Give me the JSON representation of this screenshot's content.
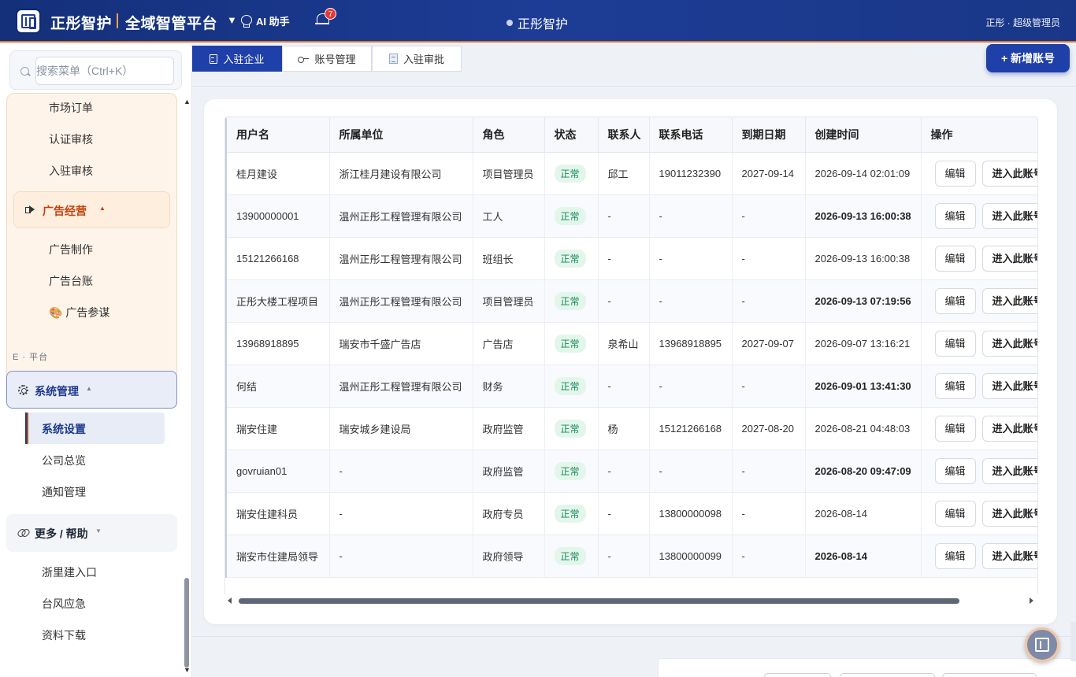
{
  "header": {
    "brand": "正彤智护",
    "platform": "全域智管平台",
    "ai_label": "AI 助手",
    "notification_count": "7",
    "center_title": "正彤智护",
    "user": "正彤 · 超级管理员"
  },
  "sidebar": {
    "search_placeholder": "搜索菜单（Ctrl+K）",
    "top_items": [
      "市场订单",
      "认证审核",
      "入驻审核"
    ],
    "ad_group": {
      "title": "广告经营",
      "items": [
        "广告制作",
        "广告台账",
        "🎨 广告参谋"
      ]
    },
    "section_label": "E · 平台",
    "system_group": {
      "title": "系统管理",
      "active_item": "系统设置",
      "items": [
        "公司总览",
        "通知管理"
      ]
    },
    "help_group": {
      "title": "更多 / 帮助",
      "items": [
        "浙里建入口",
        "台风应急",
        "资料下载"
      ]
    }
  },
  "tabs": [
    {
      "label": "入驻企业",
      "active": true
    },
    {
      "label": "账号管理",
      "active": false
    },
    {
      "label": "入驻审批",
      "active": false
    }
  ],
  "add_button": "+ 新增账号",
  "table": {
    "columns": [
      "用户名",
      "所属单位",
      "角色",
      "状态",
      "联系人",
      "联系电话",
      "到期日期",
      "创建时间",
      "操作"
    ],
    "edit_label": "编辑",
    "enter_label": "进入此账号",
    "rows": [
      {
        "username": "桂月建设",
        "unit": "浙江桂月建设有限公司",
        "role": "项目管理员",
        "status": "正常",
        "contact": "邱工",
        "phone": "19011232390",
        "expiry": "2027-09-14",
        "created": "2026-09-14 02:01:09",
        "bold": false
      },
      {
        "username": "13900000001",
        "unit": "温州正彤工程管理有限公司",
        "role": "工人",
        "status": "正常",
        "contact": "-",
        "phone": "-",
        "expiry": "-",
        "created": "2026-09-13 16:00:38",
        "bold": true
      },
      {
        "username": "15121266168",
        "unit": "温州正彤工程管理有限公司",
        "role": "班组长",
        "status": "正常",
        "contact": "-",
        "phone": "-",
        "expiry": "-",
        "created": "2026-09-13 16:00:38",
        "bold": false
      },
      {
        "username": "正彤大楼工程项目",
        "unit": "温州正彤工程管理有限公司",
        "role": "项目管理员",
        "status": "正常",
        "contact": "-",
        "phone": "-",
        "expiry": "-",
        "created": "2026-09-13 07:19:56",
        "bold": true
      },
      {
        "username": "13968918895",
        "unit": "瑞安市千盛广告店",
        "role": "广告店",
        "status": "正常",
        "contact": "泉希山",
        "phone": "13968918895",
        "expiry": "2027-09-07",
        "created": "2026-09-07 13:16:21",
        "bold": false
      },
      {
        "username": "何结",
        "unit": "温州正彤工程管理有限公司",
        "role": "财务",
        "status": "正常",
        "contact": "-",
        "phone": "-",
        "expiry": "-",
        "created": "2026-09-01 13:41:30",
        "bold": true
      },
      {
        "username": "瑞安住建",
        "unit": "瑞安城乡建设局",
        "role": "政府监管",
        "status": "正常",
        "contact": "杨",
        "phone": "15121266168",
        "expiry": "2027-08-20",
        "created": "2026-08-21 04:48:03",
        "bold": false
      },
      {
        "username": "govruian01",
        "unit": "-",
        "role": "政府监管",
        "status": "正常",
        "contact": "-",
        "phone": "-",
        "expiry": "-",
        "created": "2026-08-20 09:47:09",
        "bold": true
      },
      {
        "username": "瑞安住建科员",
        "unit": "-",
        "role": "政府专员",
        "status": "正常",
        "contact": "-",
        "phone": "13800000098",
        "expiry": "-",
        "created": "2026-08-14",
        "bold": false
      },
      {
        "username": "瑞安市住建局领导",
        "unit": "-",
        "role": "政府领导",
        "status": "正常",
        "contact": "-",
        "phone": "13800000099",
        "expiry": "-",
        "created": "2026-08-14",
        "bold": true
      }
    ]
  }
}
